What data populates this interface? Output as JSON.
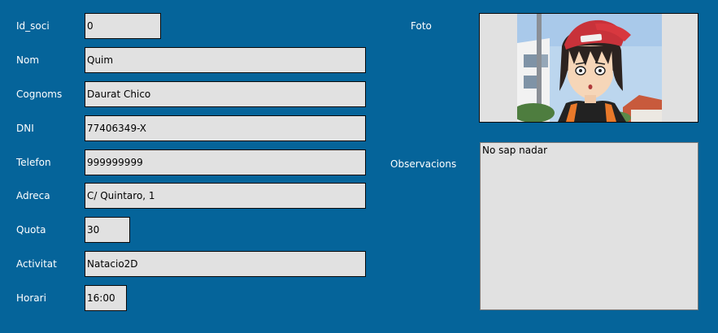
{
  "form": {
    "fields": [
      {
        "label": "Id_soci",
        "value": "0"
      },
      {
        "label": "Nom",
        "value": "Quim"
      },
      {
        "label": "Cognoms",
        "value": "Daurat Chico"
      },
      {
        "label": "DNI",
        "value": "77406349-X"
      },
      {
        "label": "Telefon",
        "value": "999999999"
      },
      {
        "label": "Adreca",
        "value": "C/ Quintaro, 1"
      },
      {
        "label": "Quota",
        "value": "30"
      },
      {
        "label": "Activitat",
        "value": "Natacio2D"
      },
      {
        "label": "Horari",
        "value": "16:00"
      }
    ],
    "foto_label": "Foto",
    "observacions_label": "Observacions",
    "observacions_value": "No sap nadar"
  },
  "colors": {
    "background": "#05649a",
    "field_bg": "#e1e1e1"
  }
}
